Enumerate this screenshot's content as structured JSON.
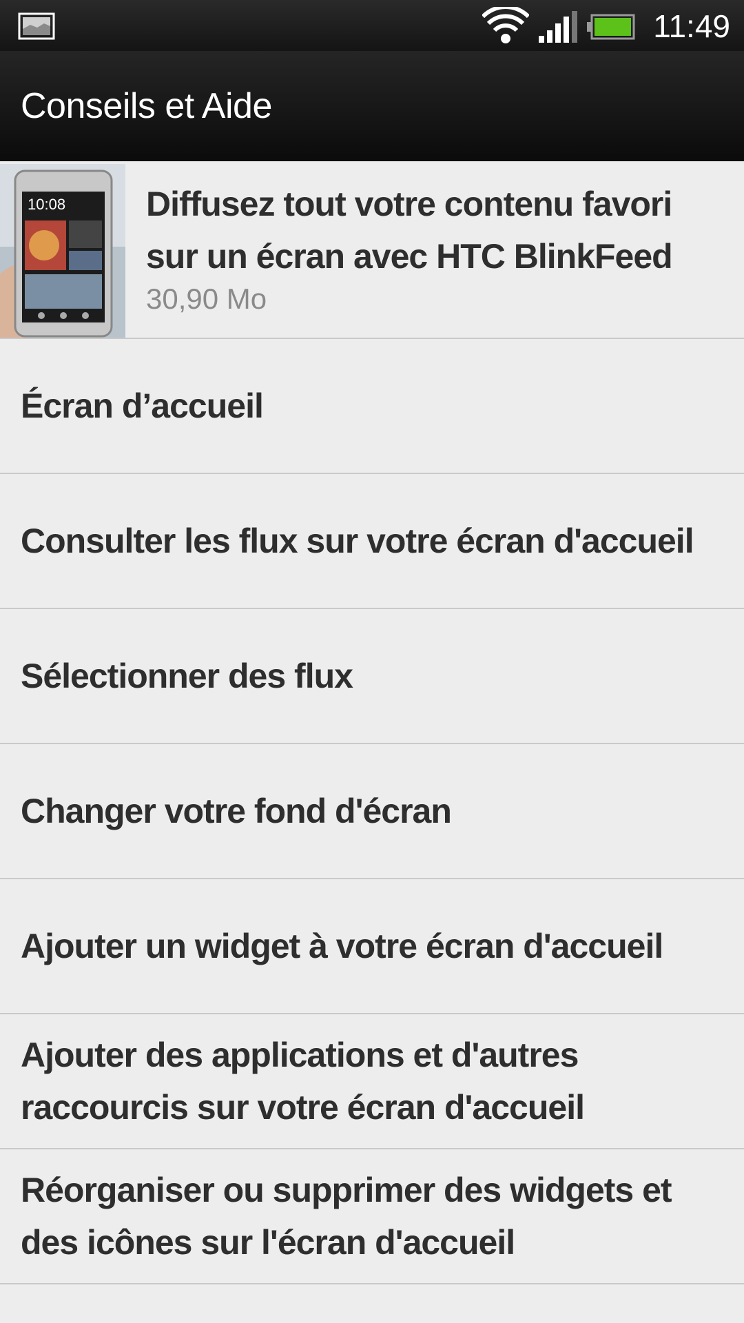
{
  "status_bar": {
    "time": "11:49",
    "icons": [
      "notification-image-icon",
      "wifi-icon",
      "signal-icon",
      "battery-icon"
    ],
    "battery_color": "#5cc21a"
  },
  "action_bar": {
    "title": "Conseils et Aide"
  },
  "featured": {
    "title": "Diffusez tout votre contenu favori sur un écran avec HTC BlinkFeed",
    "size": "30,90 Mo",
    "thumbnail_icon": "phone-thumbnail-icon"
  },
  "items": [
    {
      "label": "Écran d’accueil"
    },
    {
      "label": "Consulter les flux sur votre écran d'accueil"
    },
    {
      "label": "Sélectionner des flux"
    },
    {
      "label": "Changer votre fond d'écran"
    },
    {
      "label": "Ajouter un widget à votre écran d'accueil"
    },
    {
      "label": "Ajouter des applications et d'autres raccourcis sur votre écran d'accueil"
    },
    {
      "label": "Réorganiser ou supprimer des widgets et des icônes sur l'écran d'accueil"
    }
  ]
}
